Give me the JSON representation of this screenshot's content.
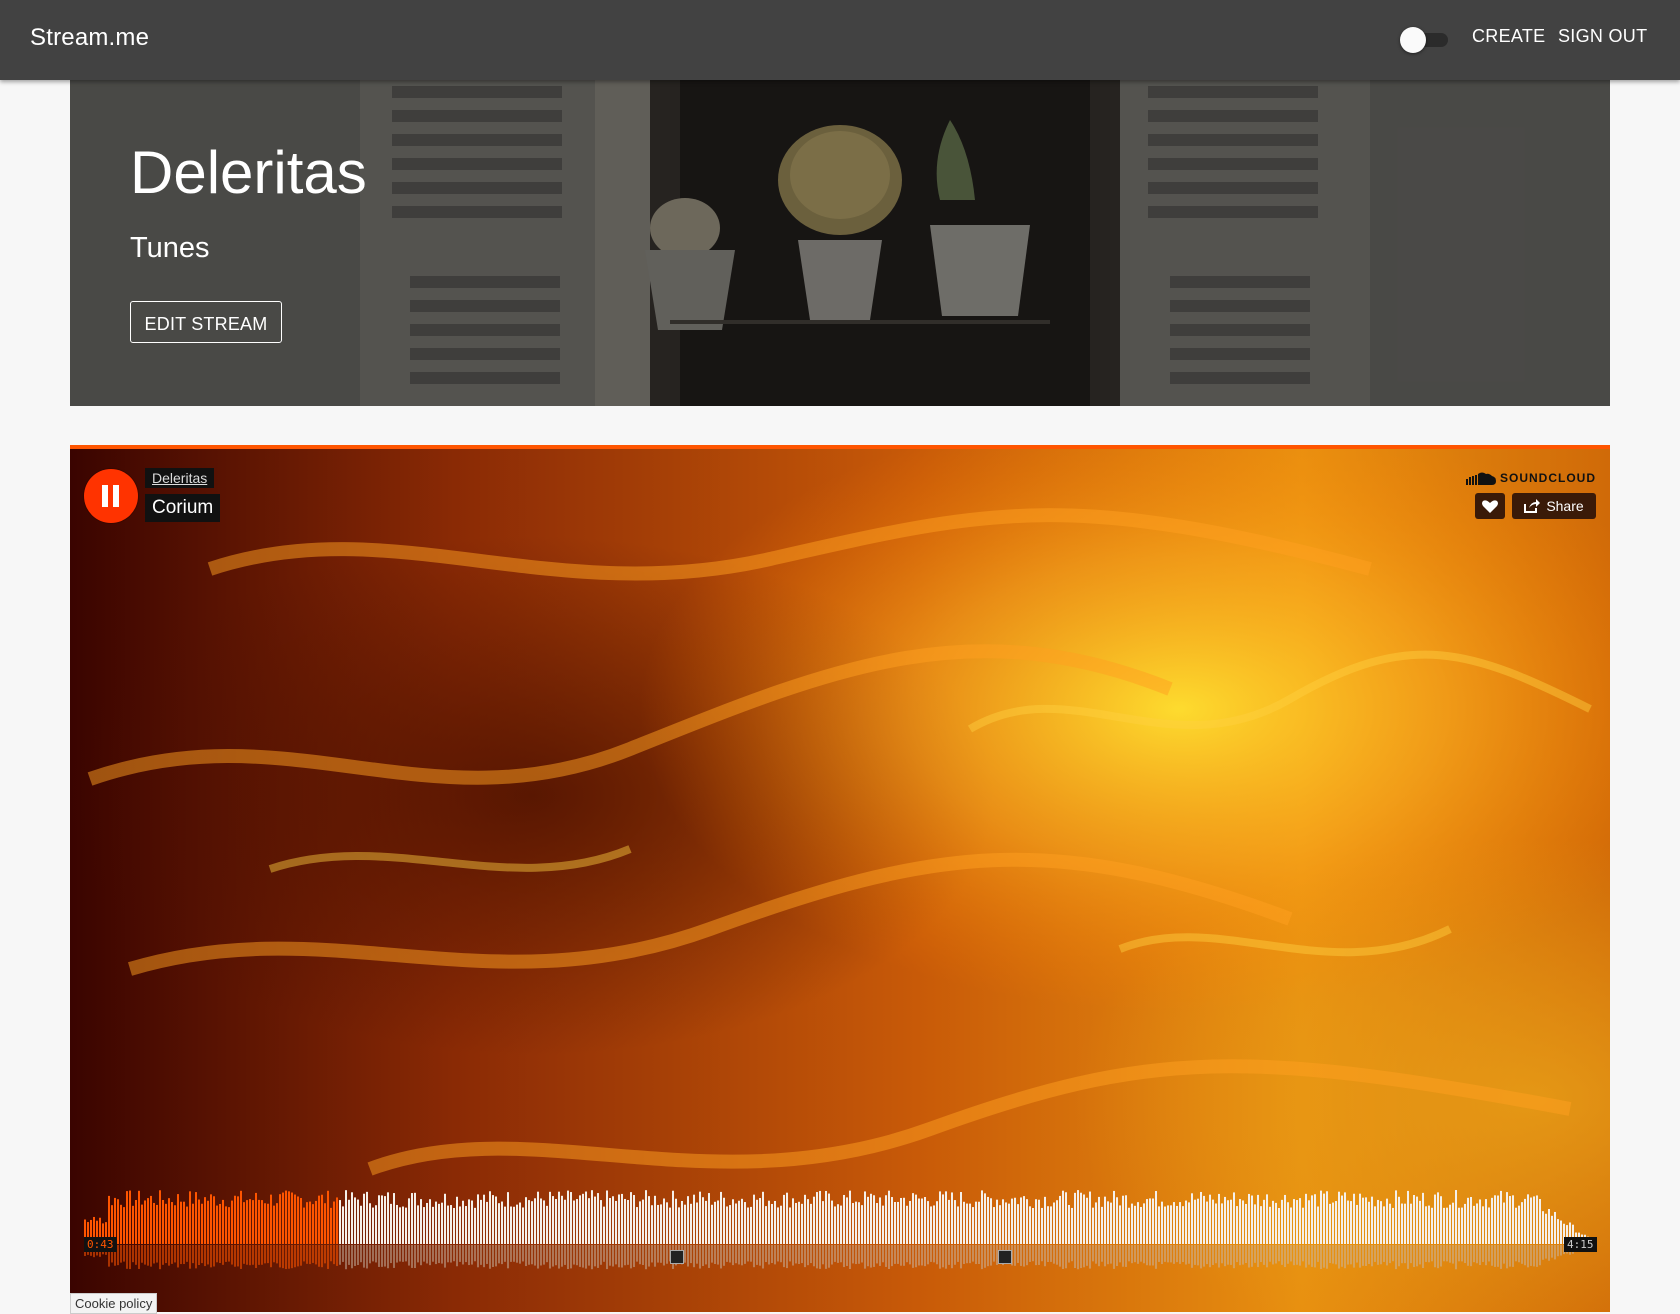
{
  "appbar": {
    "brand": "Stream.me",
    "dark_mode_toggle": false,
    "create_label": "CREATE",
    "signout_label": "SIGN OUT"
  },
  "hero": {
    "title": "Deleritas",
    "subtitle": "Tunes",
    "edit_label": "EDIT STREAM"
  },
  "player": {
    "artist": "Deleritas",
    "track": "Corium",
    "brand": "SOUNDCLOUD",
    "share_label": "Share",
    "current_time": "0:43",
    "total_time": "4:15",
    "progress": 0.1686,
    "accent": "#ff5500",
    "icons": {
      "play": "pause-icon",
      "like": "heart-icon",
      "share": "share-icon",
      "logo": "soundcloud-cloud-icon"
    }
  },
  "footer": {
    "cookie_label": "Cookie policy"
  }
}
